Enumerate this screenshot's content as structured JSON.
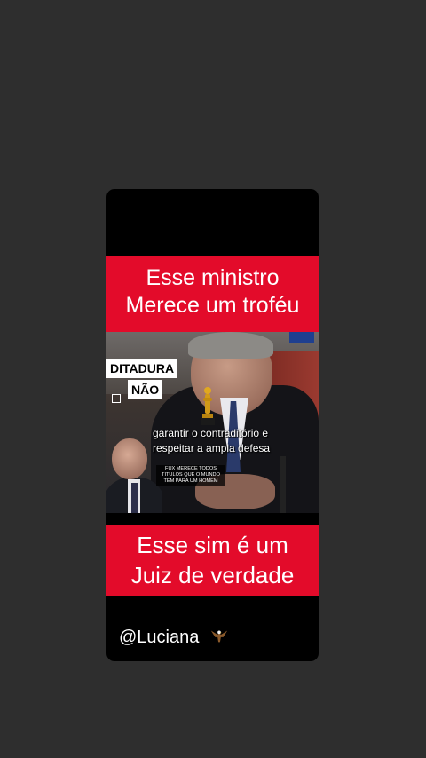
{
  "post": {
    "top_banner": {
      "line1": "Esse ministro",
      "line2": "Merece um troféu"
    },
    "video": {
      "overlay_label_line1": "DITADURA",
      "overlay_label_line2": "NÃO",
      "subtitle_line1": "garantir o contraditório e",
      "subtitle_line2": "respeitar a ampla defesa",
      "inset_caption_line1": "FUX MERECE TODOS",
      "inset_caption_line2": "TITULOS QUE O MUNDO",
      "inset_caption_line3": "TEM PARA UM HOMEM"
    },
    "bottom_banner": {
      "line1": "Esse sim é um",
      "line2": "Juiz de verdade"
    },
    "handle": "@Luciana",
    "handle_icon": "eagle-icon"
  },
  "colors": {
    "background": "#2e2e2e",
    "card": "#000000",
    "banner": "#e30b2a",
    "text": "#ffffff"
  }
}
